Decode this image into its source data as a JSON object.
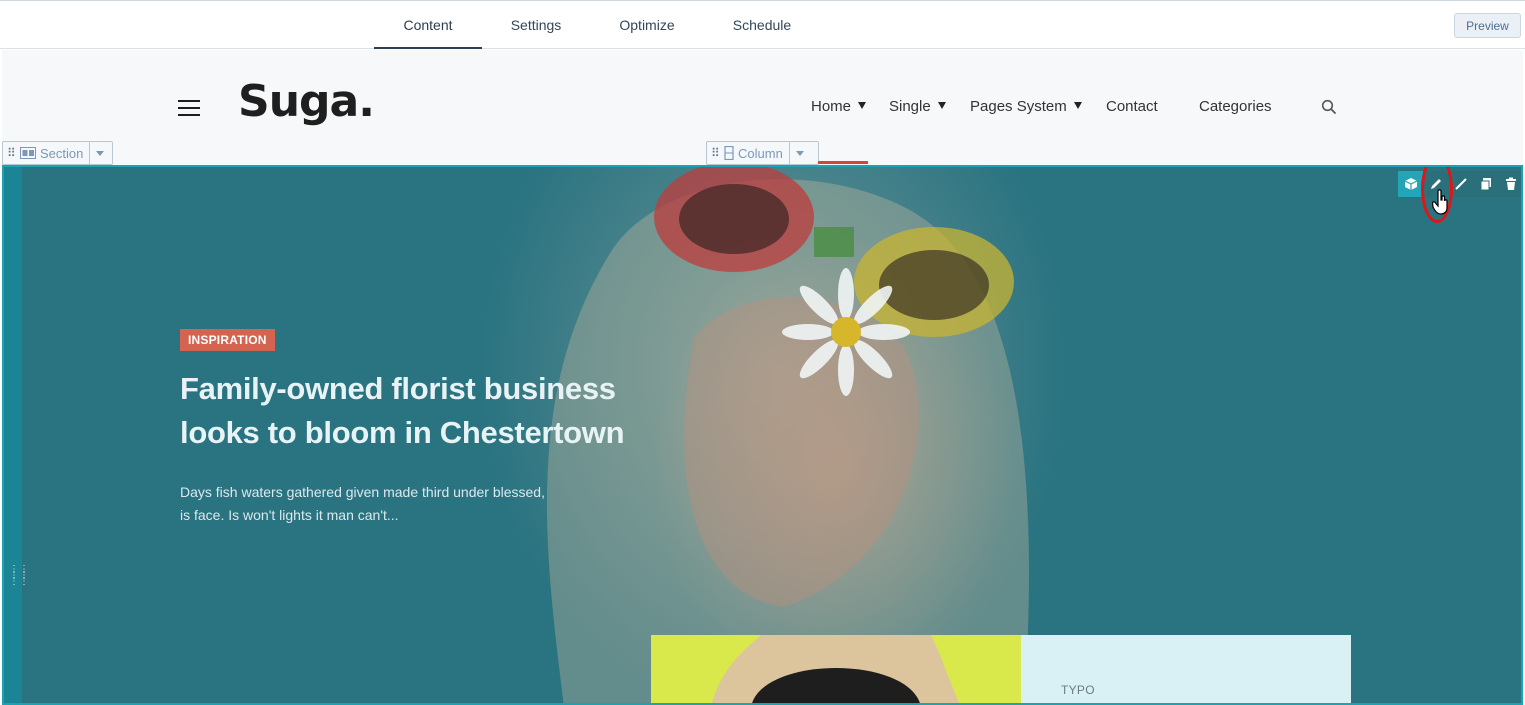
{
  "editor": {
    "tabs": [
      {
        "label": "Content",
        "active": true
      },
      {
        "label": "Settings",
        "active": false
      },
      {
        "label": "Optimize",
        "active": false
      },
      {
        "label": "Schedule",
        "active": false
      }
    ],
    "preview_label": "Preview"
  },
  "site": {
    "logo": "Suga.",
    "nav": [
      {
        "label": "Home",
        "dropdown": true
      },
      {
        "label": "Single",
        "dropdown": true
      },
      {
        "label": "Pages System",
        "dropdown": true
      },
      {
        "label": "Contact",
        "dropdown": false
      },
      {
        "label": "Categories",
        "dropdown": false
      }
    ],
    "icons": [
      "hamburger-icon",
      "search-icon"
    ]
  },
  "toolbars": {
    "section_label": "Section",
    "column_label": "Column",
    "module_actions": [
      "cube-icon",
      "pencil-icon",
      "style-icon",
      "clone-icon",
      "trash-icon"
    ]
  },
  "hero": {
    "category": "INSPIRATION",
    "headline_line1": "Family-owned florist business",
    "headline_line2": "looks to bloom in Chestertown",
    "excerpt_line1": "Days fish waters gathered given made third under blessed,",
    "excerpt_line2": "is face. Is won't lights it man can't...",
    "card_label": "TYPO"
  },
  "colors": {
    "hero_overlay": "#2a7381",
    "selection_border": "#1aa3b3",
    "badge": "#d4634f",
    "highlight": "#e01616"
  }
}
